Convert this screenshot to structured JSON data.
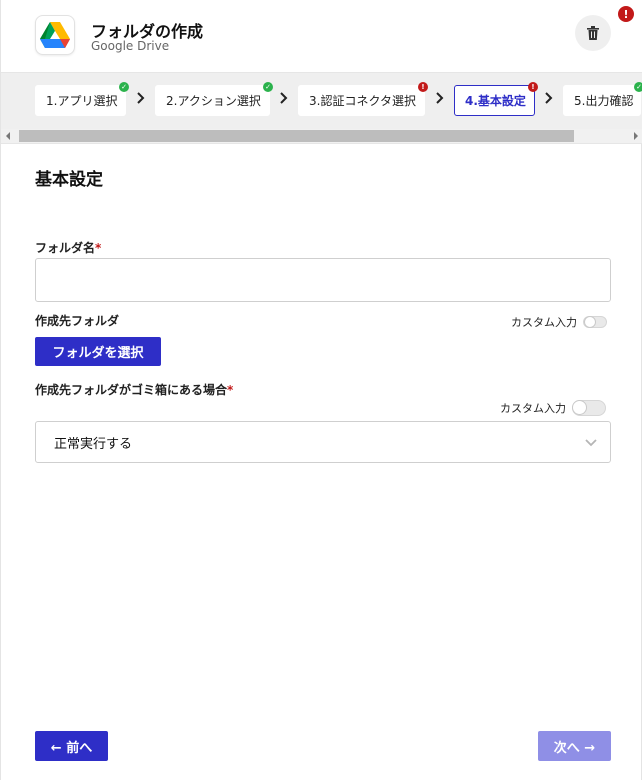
{
  "header": {
    "title": "フォルダの作成",
    "subtitle": "Google Drive",
    "alert_badge": "!"
  },
  "steps": [
    {
      "label": "1.アプリ選択",
      "status": "ok"
    },
    {
      "label": "2.アクション選択",
      "status": "ok"
    },
    {
      "label": "3.認証コネクタ選択",
      "status": "error"
    },
    {
      "label": "4.基本設定",
      "status": "error"
    },
    {
      "label": "5.出力確認",
      "status": "ok"
    }
  ],
  "form": {
    "section_title": "基本設定",
    "folder_name": {
      "label": "フォルダ名",
      "required_mark": "*",
      "value": "",
      "placeholder": ""
    },
    "dest_folder": {
      "label": "作成先フォルダ",
      "custom_input_label": "カスタム入力",
      "select_button": "フォルダを選択"
    },
    "trash_behavior": {
      "label": "作成先フォルダがゴミ箱にある場合",
      "required_mark": "*",
      "custom_input_label": "カスタム入力",
      "selected": "正常実行する"
    }
  },
  "footer": {
    "prev_label": "← 前へ",
    "next_label": "次へ →"
  },
  "colors": {
    "accent": "#2e2ec7",
    "accent_disabled": "#8f8fe6",
    "error": "#c21919",
    "success": "#2bb24c"
  }
}
